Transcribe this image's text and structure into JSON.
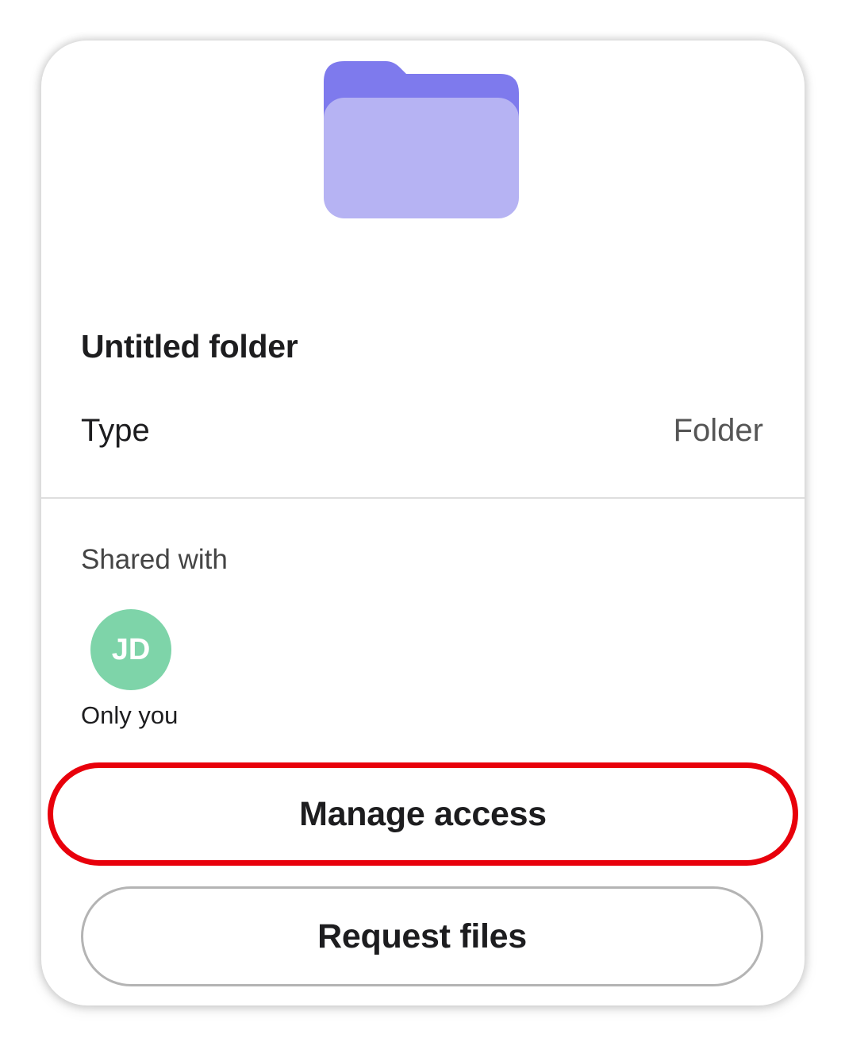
{
  "folder": {
    "icon": "folder-icon",
    "back_color": "#7e7aed",
    "front_color": "#b6b3f3",
    "title": "Untitled folder"
  },
  "details": {
    "type_label": "Type",
    "type_value": "Folder"
  },
  "sharing": {
    "label": "Shared with",
    "avatar_initials": "JD",
    "avatar_color": "#7ed4a9",
    "avatar_caption": "Only you"
  },
  "actions": {
    "manage_access_label": "Manage access",
    "request_files_label": "Request files",
    "highlight_color": "#e8000b"
  }
}
